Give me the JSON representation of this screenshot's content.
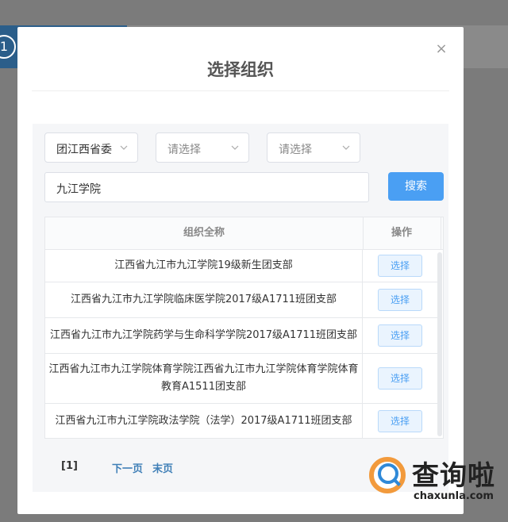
{
  "background": {
    "step_number": "1"
  },
  "dialog": {
    "title": "选择组织",
    "close_glyph": "×"
  },
  "filters": {
    "province": "团江西省委",
    "city_placeholder": "请选择",
    "school_placeholder": "请选择",
    "keyword": "九江学院",
    "search_label": "搜索"
  },
  "table": {
    "columns": [
      "组织全称",
      "操作"
    ],
    "rows": [
      {
        "name": "江西省九江市九江学院19级新生团支部",
        "action": "选择"
      },
      {
        "name": "江西省九江市九江学院临床医学院2017级A1711班团支部",
        "action": "选择"
      },
      {
        "name": "江西省九江市九江学院药学与生命科学学院2017级A1711班团支部",
        "action": "选择"
      },
      {
        "name": "江西省九江市九江学院体育学院江西省九江市九江学院体育学院体育教育A1511团支部",
        "action": "选择"
      },
      {
        "name": "江西省九江市九江学院政法学院（法学）2017级A1711班团支部",
        "action": "选择"
      }
    ]
  },
  "pagination": {
    "current": "[1]",
    "next": "下一页",
    "last": "末页"
  },
  "watermark": {
    "brand": "查询啦",
    "url": "chaxunla.com"
  },
  "colors": {
    "accent": "#4a9ff3",
    "link": "#3f7fb7",
    "overlay": "#7b7b7b"
  }
}
